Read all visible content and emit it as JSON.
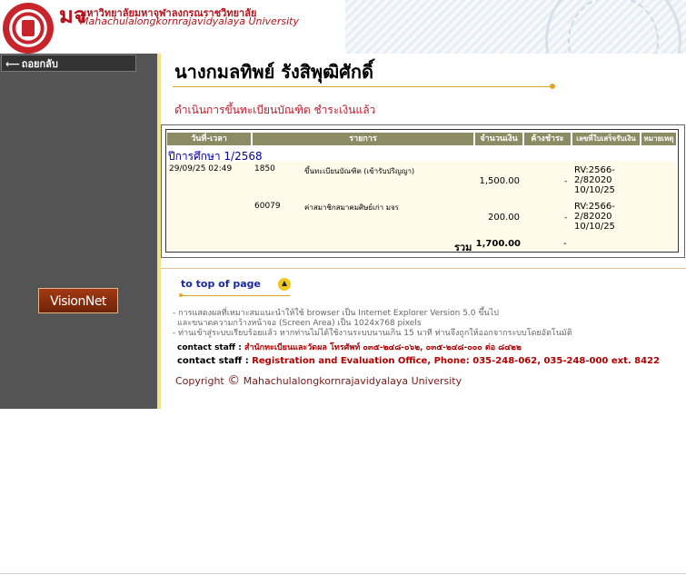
{
  "header": {
    "logo_mark": "มจ",
    "univ_thai": "มหาวิทยาลัยมหาจุฬาลงกรณราชวิทยาลัย",
    "univ_eng": "Mahachulalongkornrajavidyalaya University"
  },
  "sidebar": {
    "back_label": "ถอยกลับ",
    "visionnet_label": "VisionNet"
  },
  "main": {
    "student_name": "นางกมลทิพย์ รังสิพุฒิศักดิ์",
    "status_text": "ดำเนินการขึ้นทะเบียนบัณฑิต ชำระเงินแล้ว"
  },
  "table": {
    "headers": [
      "วันที่-เวลา",
      "รายการ",
      "จำนวนเงิน",
      "ค้างชำระ",
      "เลขที่ใบเสร็จรับเงิน",
      "หมายเหตุ"
    ],
    "year_label": "ปีการศึกษา 1/2568",
    "rows": [
      {
        "datetime": "29/09/25 02:49",
        "code": "1850",
        "item": "ขึ้นทะเบียนบัณฑิต (เข้ารับปริญญา)",
        "amount": "1,500.00",
        "outstanding": "-",
        "receipt_1": "RV:2566-",
        "receipt_2": "2/82020",
        "receipt_3": "10/10/25"
      },
      {
        "datetime": "",
        "code": "60079",
        "item": "ค่าสมาชิกสมาคมศิษย์เก่า มจร",
        "amount": "200.00",
        "outstanding": "-",
        "receipt_1": "RV:2566-",
        "receipt_2": "2/82020",
        "receipt_3": "10/10/25"
      }
    ],
    "total_label": "รวม",
    "total_value": "1,700.00",
    "total_outstanding": "-"
  },
  "footer": {
    "top_link": "to top of page",
    "note_1": "- การแสดงผลที่เหมาะสมแนะนำให้ใช้ browser เป็น Internet Explorer Version 5.0 ขึ้นไป",
    "note_2": "และขนาดความกว้างหน้าจอ (Screen Area) เป็น 1024x768 pixels",
    "note_3": "- ท่านเข้าสู่ระบบเรียบร้อยแล้ว หากท่านไม่ได้ใช้งานระบบนานเกิน 15 นาที ท่านจึงถูกให้ออกจากระบบโดยอัตโนมัติ",
    "contact_label": "contact staff :",
    "contact_thai": "สำนักทะเบียนและวัดผล โทรศัพท์ ๐๓๕-๒๔๘-๐๖๒, ๐๓๕-๒๔๘-๐๐๐ ต่อ ๘๔๒๒",
    "contact_eng": "Registration and Evaluation Office, Phone: 035-248-062, 035-248-000 ext. 8422",
    "copyright_word": "Copyright",
    "copyright_symbol": "©",
    "copyright_holder": "Mahachulalongkornrajavidyalaya University"
  },
  "colors": {
    "brand_red": "#b5121b",
    "sidebar_gray": "#545454",
    "accent_gold": "#e3a526",
    "table_header": "#8c8c64",
    "link_blue": "#1a2aa0"
  }
}
